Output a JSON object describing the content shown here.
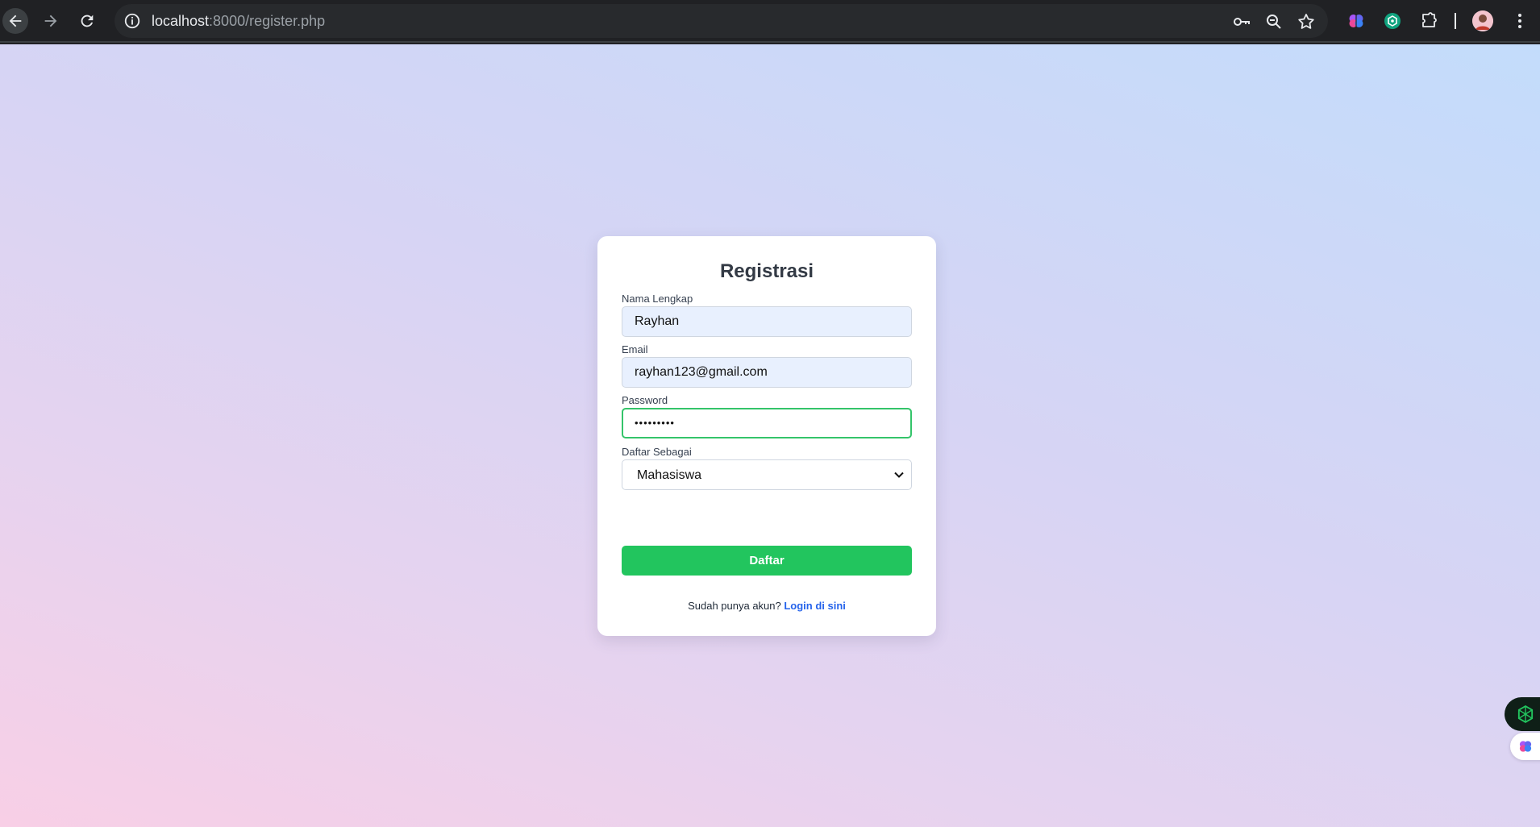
{
  "browser": {
    "url_host": "localhost",
    "url_rest": ":8000/register.php",
    "icons": {
      "back": "arrow-left-icon",
      "forward": "arrow-right-icon",
      "reload": "reload-icon",
      "site_info": "info-icon",
      "password": "key-icon",
      "zoom": "zoom-icon",
      "bookmark": "star-icon",
      "ext_1": "brain-icon",
      "ext_2": "chatgpt-icon",
      "extensions": "puzzle-icon",
      "menu": "kebab-menu-icon"
    }
  },
  "form": {
    "title": "Registrasi",
    "name_label": "Nama Lengkap",
    "name_value": "Rayhan",
    "email_label": "Email",
    "email_value": "rayhan123@gmail.com",
    "password_label": "Password",
    "password_value": "•••••••••",
    "role_label": "Daftar Sebagai",
    "role_value": "Mahasiswa",
    "submit_label": "Daftar",
    "login_prompt": "Sudah punya akun?",
    "login_link": "Login di sini"
  },
  "colors": {
    "accent_green": "#22c55e",
    "focus_border": "#34c46a",
    "link_blue": "#2563eb",
    "autofill_bg": "#e8f0fe"
  }
}
